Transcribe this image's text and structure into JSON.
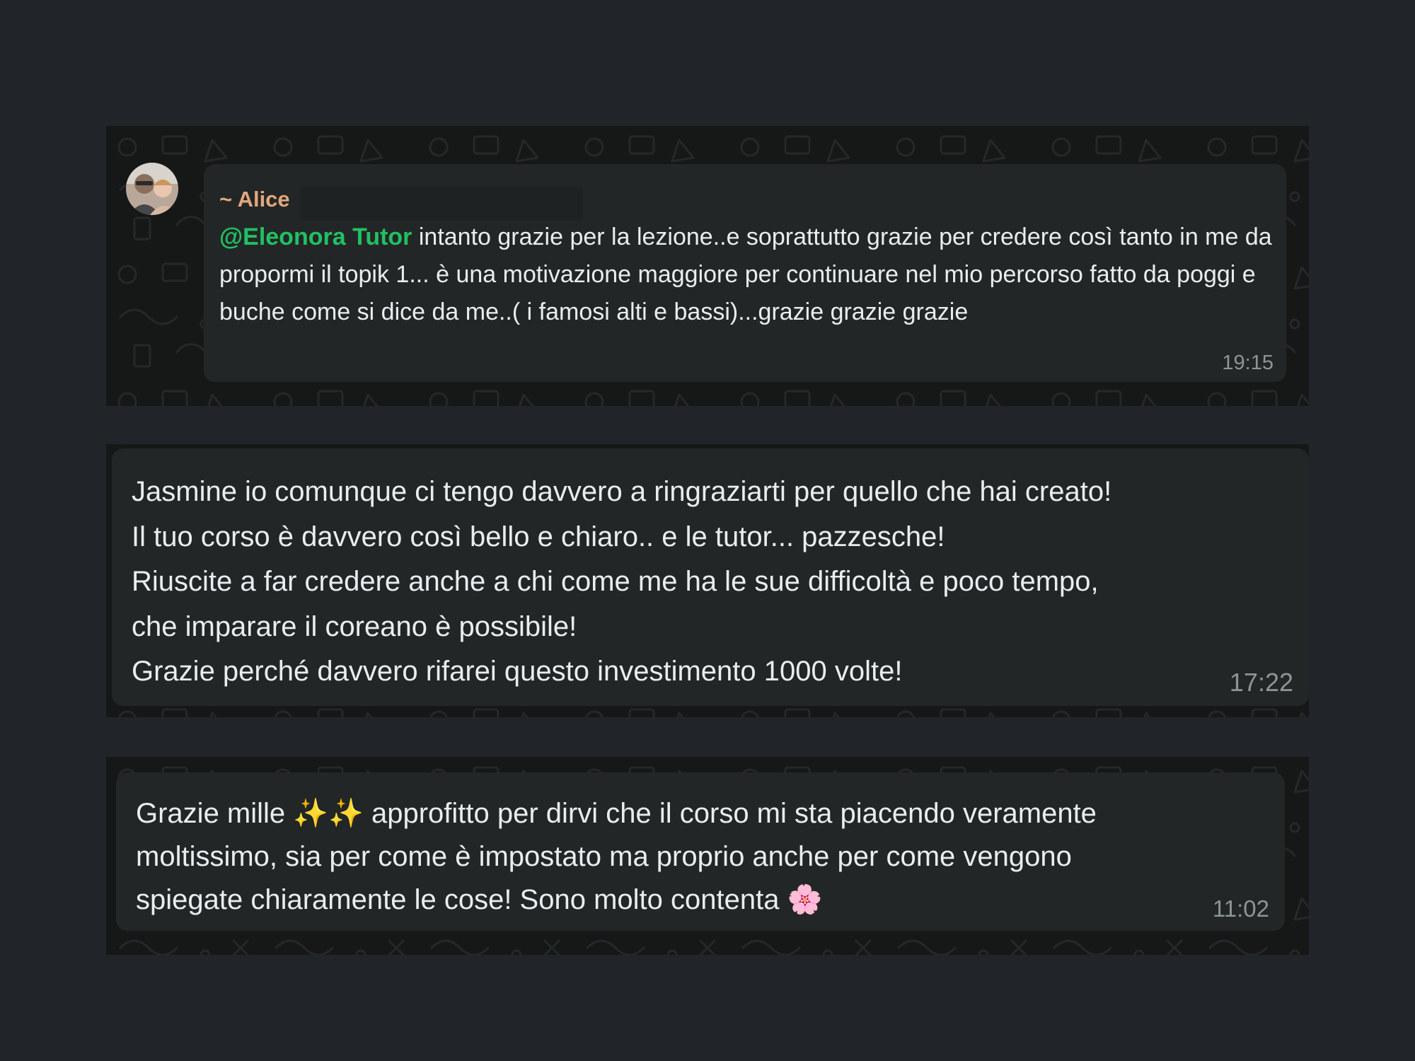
{
  "colors": {
    "page_bg": "#212529",
    "chat_bg": "#161818",
    "bubble_bg": "#232626",
    "text": "#e9edef",
    "mention": "#21c063",
    "sender_name": "#e2a77d",
    "timestamp": "#8c9599"
  },
  "messages": [
    {
      "sender": "~ Alice",
      "avatar_icon": "user-avatar-photo",
      "mention": "@Eleonora Tutor",
      "text": " intanto grazie per la lezione..e soprattutto grazie per credere così tanto in me da propormi il topik 1... è una motivazione maggiore per continuare nel mio percorso fatto da poggi e buche come si dice da me..( i famosi alti e bassi)...grazie grazie grazie",
      "time": "19:15"
    },
    {
      "lines": [
        "Jasmine io comunque ci tengo davvero a ringraziarti per quello che hai creato!",
        "Il tuo corso è davvero così bello e chiaro.. e le tutor... pazzesche!",
        "Riuscite a far credere anche a chi come me ha le sue difficoltà e poco tempo,",
        "che imparare il coreano è possibile!",
        "Grazie perché davvero rifarei questo investimento 1000 volte!"
      ],
      "time": "17:22"
    },
    {
      "lines": [
        "Grazie mille ✨✨ approfitto per dirvi che il corso mi sta piacendo veramente",
        "moltissimo, sia per come è impostato ma proprio anche per come vengono",
        "spiegate chiaramente le cose! Sono molto contenta 🌸"
      ],
      "time": "11:02"
    }
  ]
}
